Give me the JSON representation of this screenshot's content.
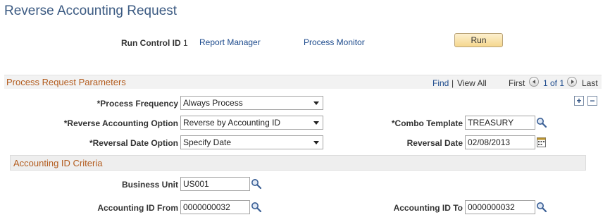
{
  "page": {
    "title": "Reverse Accounting Request"
  },
  "run_control": {
    "label": "Run Control ID",
    "value": "1",
    "report_manager": "Report Manager",
    "process_monitor": "Process Monitor",
    "run_label": "Run"
  },
  "params": {
    "section_title": "Process Request Parameters",
    "nav": {
      "find": "Find",
      "separator": "|",
      "view_all": "View All",
      "first": "First",
      "count": "1 of 1",
      "last": "Last"
    },
    "add_label": "+",
    "remove_label": "−",
    "process_frequency": {
      "label": "*Process Frequency",
      "value": "Always Process"
    },
    "reverse_option": {
      "label": "*Reverse Accounting Option",
      "value": "Reverse by Accounting ID"
    },
    "reversal_date_option": {
      "label": "*Reversal Date Option",
      "value": "Specify Date"
    },
    "combo_template": {
      "label": "*Combo Template",
      "value": "TREASURY"
    },
    "reversal_date": {
      "label": "Reversal Date",
      "value": "02/08/2013"
    }
  },
  "criteria": {
    "section_title": "Accounting ID Criteria",
    "business_unit": {
      "label": "Business Unit",
      "value": "US001"
    },
    "accounting_id_from": {
      "label": "Accounting ID From",
      "value": "0000000032"
    },
    "accounting_id_to": {
      "label": "Accounting ID To",
      "value": "0000000032"
    }
  }
}
